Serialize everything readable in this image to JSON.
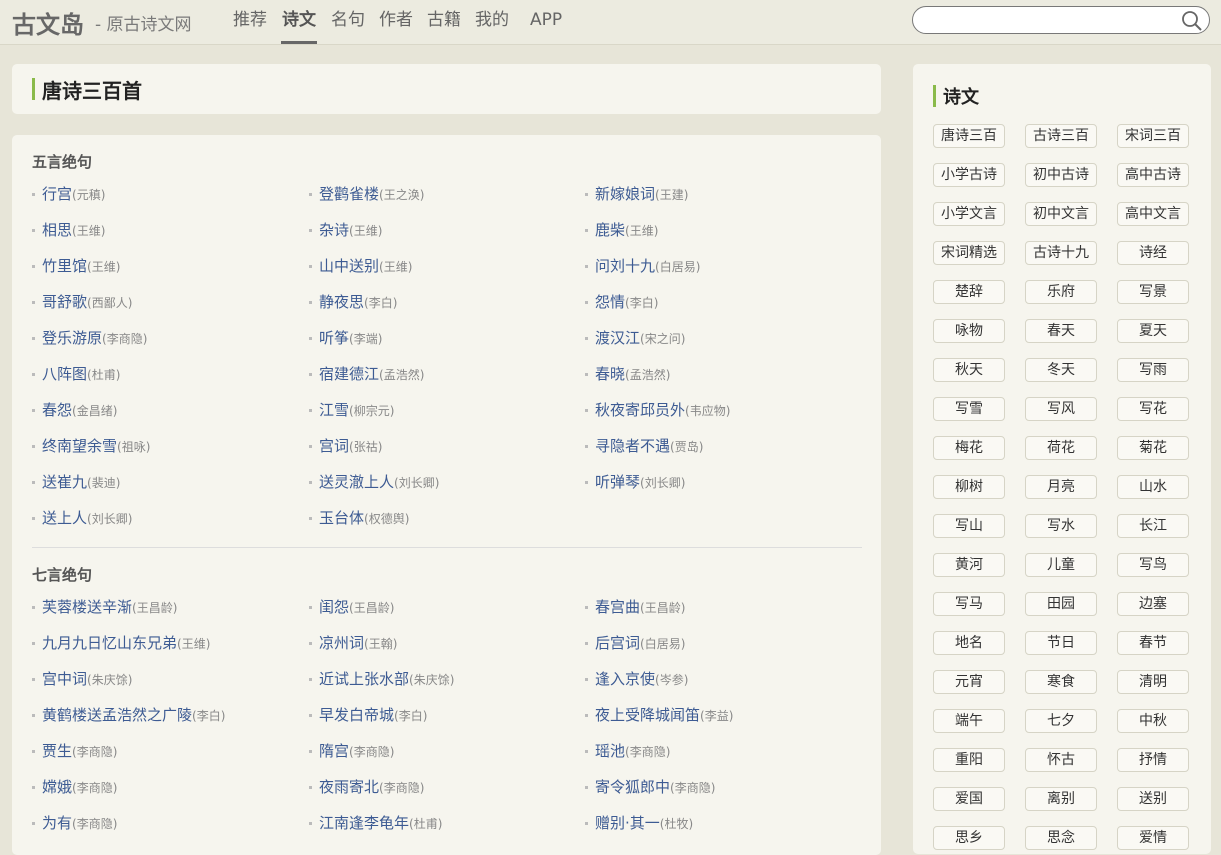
{
  "header": {
    "logo": "古文岛",
    "logo_sub": "- 原古诗文网",
    "nav": [
      "推荐",
      "诗文",
      "名句",
      "作者",
      "古籍",
      "我的",
      "APP"
    ],
    "active_nav": "诗文",
    "search_placeholder": ""
  },
  "page_title": "唐诗三百首",
  "sections": [
    {
      "title": "五言绝句",
      "poems": [
        {
          "title": "行宫",
          "author": "(元稹)"
        },
        {
          "title": "登鹳雀楼",
          "author": "(王之涣)"
        },
        {
          "title": "新嫁娘词",
          "author": "(王建)"
        },
        {
          "title": "相思",
          "author": "(王维)"
        },
        {
          "title": "杂诗",
          "author": "(王维)"
        },
        {
          "title": "鹿柴",
          "author": "(王维)"
        },
        {
          "title": "竹里馆",
          "author": "(王维)"
        },
        {
          "title": "山中送别",
          "author": "(王维)"
        },
        {
          "title": "问刘十九",
          "author": "(白居易)"
        },
        {
          "title": "哥舒歌",
          "author": "(西鄙人)"
        },
        {
          "title": "静夜思",
          "author": "(李白)"
        },
        {
          "title": "怨情",
          "author": "(李白)"
        },
        {
          "title": "登乐游原",
          "author": "(李商隐)"
        },
        {
          "title": "听筝",
          "author": "(李端)"
        },
        {
          "title": "渡汉江",
          "author": "(宋之问)"
        },
        {
          "title": "八阵图",
          "author": "(杜甫)"
        },
        {
          "title": "宿建德江",
          "author": "(孟浩然)"
        },
        {
          "title": "春晓",
          "author": "(孟浩然)"
        },
        {
          "title": "春怨",
          "author": "(金昌绪)"
        },
        {
          "title": "江雪",
          "author": "(柳宗元)"
        },
        {
          "title": "秋夜寄邱员外",
          "author": "(韦应物)"
        },
        {
          "title": "终南望余雪",
          "author": "(祖咏)"
        },
        {
          "title": "宫词",
          "author": "(张祜)"
        },
        {
          "title": "寻隐者不遇",
          "author": "(贾岛)"
        },
        {
          "title": "送崔九",
          "author": "(裴迪)"
        },
        {
          "title": "送灵澈上人",
          "author": "(刘长卿)"
        },
        {
          "title": "听弹琴",
          "author": "(刘长卿)"
        },
        {
          "title": "送上人",
          "author": "(刘长卿)"
        },
        {
          "title": "玉台体",
          "author": "(权德舆)"
        }
      ]
    },
    {
      "title": "七言绝句",
      "poems": [
        {
          "title": "芙蓉楼送辛渐",
          "author": "(王昌龄)"
        },
        {
          "title": "闺怨",
          "author": "(王昌龄)"
        },
        {
          "title": "春宫曲",
          "author": "(王昌龄)"
        },
        {
          "title": "九月九日忆山东兄弟",
          "author": "(王维)"
        },
        {
          "title": "凉州词",
          "author": "(王翰)"
        },
        {
          "title": "后宫词",
          "author": "(白居易)"
        },
        {
          "title": "宫中词",
          "author": "(朱庆馀)"
        },
        {
          "title": "近试上张水部",
          "author": "(朱庆馀)"
        },
        {
          "title": "逢入京使",
          "author": "(岑参)"
        },
        {
          "title": "黄鹤楼送孟浩然之广陵",
          "author": "(李白)"
        },
        {
          "title": "早发白帝城",
          "author": "(李白)"
        },
        {
          "title": "夜上受降城闻笛",
          "author": "(李益)"
        },
        {
          "title": "贾生",
          "author": "(李商隐)"
        },
        {
          "title": "隋宫",
          "author": "(李商隐)"
        },
        {
          "title": "瑶池",
          "author": "(李商隐)"
        },
        {
          "title": "嫦娥",
          "author": "(李商隐)"
        },
        {
          "title": "夜雨寄北",
          "author": "(李商隐)"
        },
        {
          "title": "寄令狐郎中",
          "author": "(李商隐)"
        },
        {
          "title": "为有",
          "author": "(李商隐)"
        },
        {
          "title": "江南逢李龟年",
          "author": "(杜甫)"
        },
        {
          "title": "赠别·其一",
          "author": "(杜牧)"
        }
      ]
    }
  ],
  "sidebar": {
    "title": "诗文",
    "tags": [
      "唐诗三百",
      "古诗三百",
      "宋词三百",
      "小学古诗",
      "初中古诗",
      "高中古诗",
      "小学文言",
      "初中文言",
      "高中文言",
      "宋词精选",
      "古诗十九",
      "诗经",
      "楚辞",
      "乐府",
      "写景",
      "咏物",
      "春天",
      "夏天",
      "秋天",
      "冬天",
      "写雨",
      "写雪",
      "写风",
      "写花",
      "梅花",
      "荷花",
      "菊花",
      "柳树",
      "月亮",
      "山水",
      "写山",
      "写水",
      "长江",
      "黄河",
      "儿童",
      "写鸟",
      "写马",
      "田园",
      "边塞",
      "地名",
      "节日",
      "春节",
      "元宵",
      "寒食",
      "清明",
      "端午",
      "七夕",
      "中秋",
      "重阳",
      "怀古",
      "抒情",
      "爱国",
      "离别",
      "送别",
      "思乡",
      "思念",
      "爱情"
    ]
  }
}
